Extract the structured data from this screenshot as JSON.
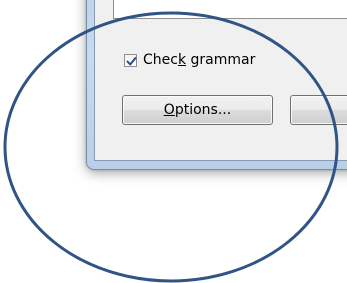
{
  "dialog": {
    "checkbox": {
      "label_prefix": "Chec",
      "label_accesskey": "k",
      "label_suffix": " grammar",
      "checked": true
    },
    "options_button": {
      "label_accesskey": "O",
      "label_rest": "ptions..."
    },
    "second_button": {
      "label": ""
    }
  },
  "annotation": {
    "shape": "ellipse",
    "color": "#2f5485"
  },
  "colors": {
    "window_frame": "#bcd3ec",
    "client_background": "#f0f0f0",
    "checkmark": "#2a4d8f"
  },
  "icons": {
    "checkbox_mark": "checkmark-icon"
  }
}
